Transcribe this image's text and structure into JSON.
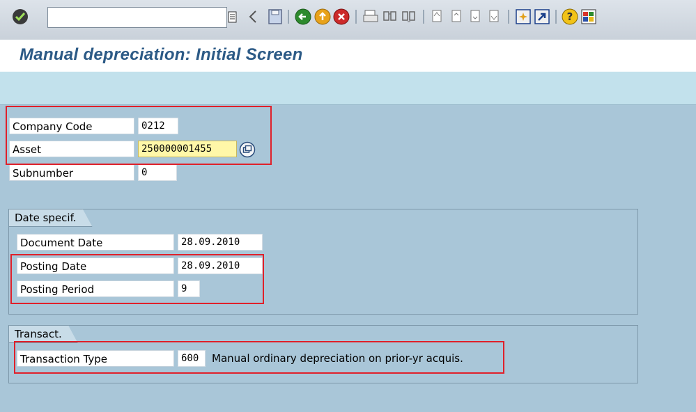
{
  "toolbar": {
    "command_field_value": "",
    "icons": [
      "enter-icon",
      "command-field-menu-icon",
      "back-arrow-icon",
      "save-icon",
      "back-icon",
      "exit-icon",
      "cancel-icon",
      "print-icon",
      "find-icon",
      "find-next-icon",
      "first-page-icon",
      "previous-page-icon",
      "next-page-icon",
      "last-page-icon",
      "create-session-icon",
      "shortcut-icon",
      "help-icon",
      "layout-settings-icon"
    ]
  },
  "title": "Manual depreciation: Initial Screen",
  "fields": {
    "company_code": {
      "label": "Company Code",
      "value": "0212"
    },
    "asset": {
      "label": "Asset",
      "value": "250000001455"
    },
    "subnumber": {
      "label": "Subnumber",
      "value": "0"
    }
  },
  "date_group": {
    "title": "Date specif.",
    "document_date": {
      "label": "Document Date",
      "value": "28.09.2010"
    },
    "posting_date": {
      "label": "Posting Date",
      "value": "28.09.2010"
    },
    "posting_period": {
      "label": "Posting Period",
      "value": "9"
    }
  },
  "transact_group": {
    "title": "Transact.",
    "transaction_type": {
      "label": "Transaction Type",
      "value": "600",
      "description": "Manual ordinary depreciation on prior-yr acquis."
    }
  },
  "colors": {
    "background": "#a9c6d8",
    "title": "#2c5a86",
    "highlight_box": "#e0202a",
    "required_field": "#fff7a8"
  }
}
